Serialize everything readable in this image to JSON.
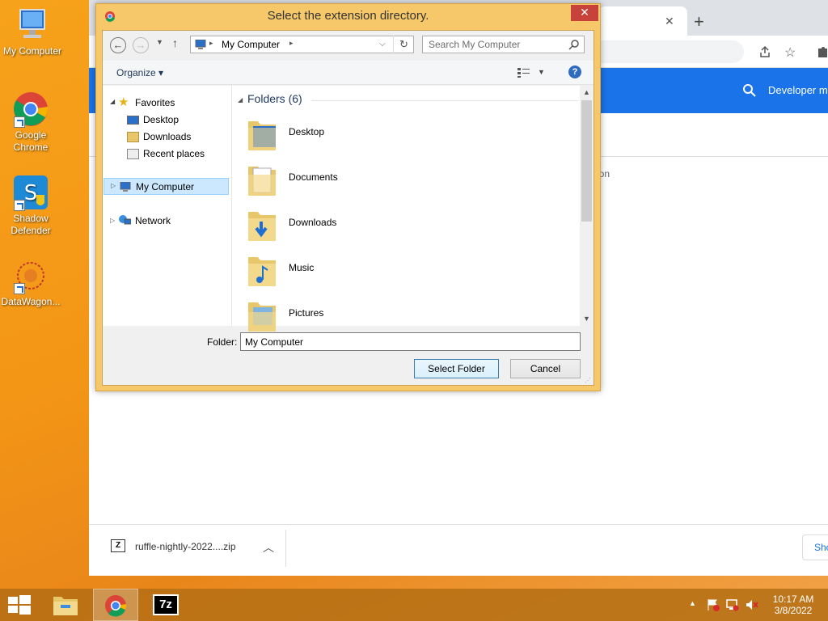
{
  "desktop": {
    "icons": [
      {
        "label": "My Computer"
      },
      {
        "label": "Google Chrome"
      },
      {
        "label": "Shadow Defender"
      },
      {
        "label": "DataWagon..."
      }
    ]
  },
  "chrome": {
    "tab_close": "✕",
    "new_tab": "+",
    "header_search_text": "Developer m",
    "partial_text": "ion",
    "download": {
      "filename": "ruffle-nightly-2022....zip"
    },
    "show_all_label": "Sho"
  },
  "dialog": {
    "title": "Select the extension directory.",
    "close": "✕",
    "address": {
      "location": "My Computer"
    },
    "search_placeholder": "Search My Computer",
    "organize_label": "Organize ▾",
    "nav": {
      "favorites": "Favorites",
      "fav_items": [
        "Desktop",
        "Downloads",
        "Recent places"
      ],
      "my_computer": "My Computer",
      "network": "Network"
    },
    "folders_header": "Folders (6)",
    "folders": [
      "Desktop",
      "Documents",
      "Downloads",
      "Music",
      "Pictures"
    ],
    "folder_label": "Folder:",
    "folder_value": "My Computer",
    "select_button": "Select Folder",
    "cancel_button": "Cancel"
  },
  "taskbar": {
    "time": "10:17 AM",
    "date": "3/8/2022"
  },
  "colors": {
    "desktop_orange": "#f39516",
    "dialog_frame": "#f7c86a",
    "chrome_blue": "#1a73e8",
    "close_red": "#c7423a"
  }
}
